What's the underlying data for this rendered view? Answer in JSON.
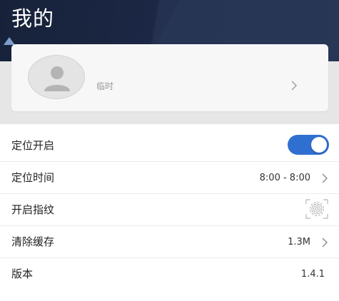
{
  "header": {
    "title": "我的"
  },
  "profile": {
    "name": "临时"
  },
  "settings": {
    "location": {
      "label": "定位开启",
      "enabled": true
    },
    "location_time": {
      "label": "定位时间",
      "value": "8:00 - 8:00"
    },
    "fingerprint": {
      "label": "开启指纹"
    },
    "clear_cache": {
      "label": "清除缓存",
      "value": "1.3M"
    },
    "version": {
      "label": "版本",
      "value": "1.4.1"
    }
  },
  "colors": {
    "header_bg": "#1f2a44",
    "toggle_on": "#2f6fd0",
    "gray_zone": "#e6e6e6"
  },
  "icons": {
    "avatar": "person-icon",
    "chevron": "chevron-right-icon",
    "fingerprint": "fingerprint-icon"
  }
}
